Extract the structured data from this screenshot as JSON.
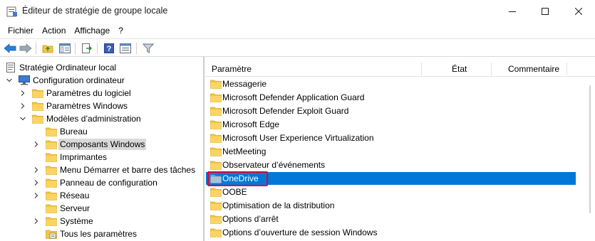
{
  "window": {
    "title": "Éditeur de stratégie de groupe locale",
    "controls": {
      "minimize": "minimize-icon",
      "maximize": "maximize-icon",
      "close": "close-icon"
    }
  },
  "menu": [
    "Fichier",
    "Action",
    "Affichage",
    "?"
  ],
  "toolbar": [
    "back-icon",
    "forward-icon",
    "up-folder-icon",
    "show-hide-tree-icon",
    "export-list-icon",
    "help-icon",
    "properties-icon",
    "filter-icon"
  ],
  "tree": [
    {
      "label": "Stratégie Ordinateur local",
      "expand": "none",
      "icon": "policy-doc-icon"
    },
    {
      "label": "Configuration ordinateur",
      "expand": "open",
      "icon": "computer-icon"
    },
    {
      "label": "Paramètres du logiciel",
      "expand": "closed",
      "icon": "folder-icon"
    },
    {
      "label": "Paramètres Windows",
      "expand": "closed",
      "icon": "folder-icon"
    },
    {
      "label": "Modèles d’administration",
      "expand": "open",
      "icon": "folder-icon"
    },
    {
      "label": "Bureau",
      "expand": "none",
      "icon": "folder-icon"
    },
    {
      "label": "Composants Windows",
      "expand": "closed",
      "icon": "folder-icon",
      "selected": true
    },
    {
      "label": "Imprimantes",
      "expand": "none",
      "icon": "folder-icon"
    },
    {
      "label": "Menu Démarrer et barre des tâches",
      "expand": "closed",
      "icon": "folder-icon"
    },
    {
      "label": "Panneau de configuration",
      "expand": "closed",
      "icon": "folder-icon"
    },
    {
      "label": "Réseau",
      "expand": "closed",
      "icon": "folder-icon"
    },
    {
      "label": "Serveur",
      "expand": "none",
      "icon": "folder-icon"
    },
    {
      "label": "Système",
      "expand": "closed",
      "icon": "folder-icon"
    },
    {
      "label": "Tous les paramètres",
      "expand": "none",
      "icon": "all-settings-icon"
    }
  ],
  "list": {
    "columns": [
      "Paramètre",
      "État",
      "Commentaire"
    ],
    "rows": [
      {
        "label": "Messagerie"
      },
      {
        "label": "Microsoft Defender Application Guard"
      },
      {
        "label": "Microsoft Defender Exploit Guard"
      },
      {
        "label": "Microsoft Edge"
      },
      {
        "label": "Microsoft User Experience Virtualization"
      },
      {
        "label": "NetMeeting"
      },
      {
        "label": "Observateur d’événements"
      },
      {
        "label": "OneDrive",
        "selected": true
      },
      {
        "label": "OOBE"
      },
      {
        "label": "Optimisation de la distribution"
      },
      {
        "label": "Options d’arrêt"
      },
      {
        "label": "Options d’ouverture de session Windows"
      }
    ]
  },
  "colors": {
    "selection": "#0078d7",
    "highlight_box": "#e4002b",
    "folder": "#f6c444"
  }
}
